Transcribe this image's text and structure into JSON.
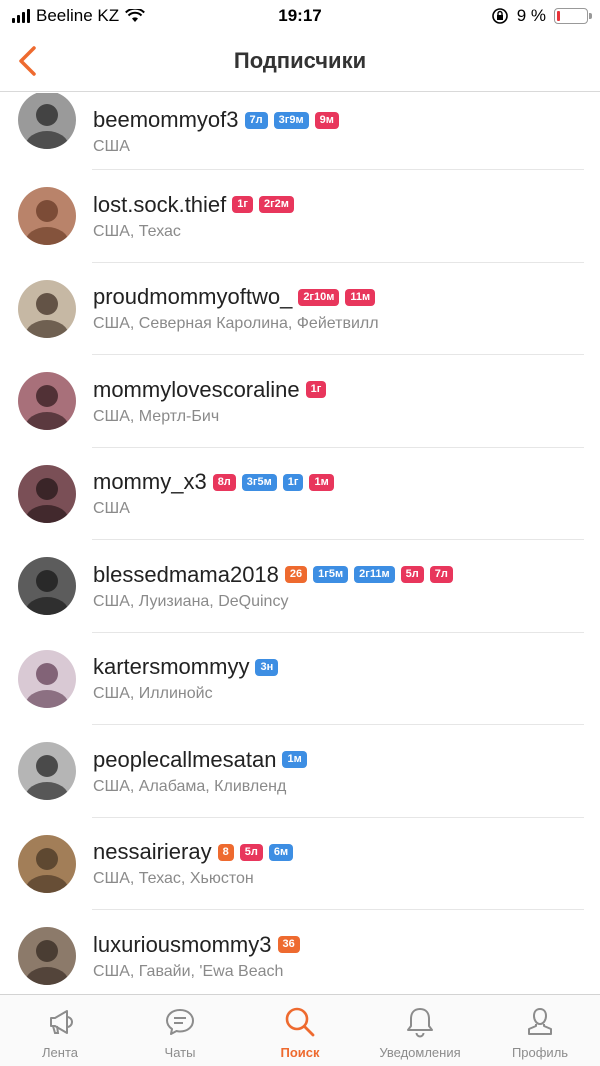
{
  "status_bar": {
    "carrier": "Beeline KZ",
    "time": "19:17",
    "battery_percent": "9 %",
    "battery_level": 0.09,
    "battery_color": "#e8343a"
  },
  "nav": {
    "back_icon": "chevron-left-icon",
    "title": "Подписчики"
  },
  "colors": {
    "accent": "#ee6a2f",
    "badge_blue": "#3d8ee3",
    "badge_pink": "#e8365c",
    "badge_orange": "#ee6a2f"
  },
  "followers": [
    {
      "name": "beemommyof3",
      "location": "США",
      "badges": [
        {
          "text": "7л",
          "color": "#3d8ee3"
        },
        {
          "text": "3г9м",
          "color": "#3d8ee3"
        },
        {
          "text": "9м",
          "color": "#e8365c"
        }
      ],
      "avatar_bg": "#9a9a9a",
      "avatar_fg": "#2d2d2d"
    },
    {
      "name": "lost.sock.thief",
      "location": "США, Техас",
      "badges": [
        {
          "text": "1г",
          "color": "#e8365c"
        },
        {
          "text": "2г2м",
          "color": "#e8365c"
        }
      ],
      "avatar_bg": "#b9836a",
      "avatar_fg": "#6d3f2a"
    },
    {
      "name": "proudmommyoftwo_",
      "location": "США, Северная Каролина, Фейетвилл",
      "badges": [
        {
          "text": "2г10м",
          "color": "#e8365c"
        },
        {
          "text": "11м",
          "color": "#e8365c"
        }
      ],
      "avatar_bg": "#c6b8a4",
      "avatar_fg": "#4a3a2e"
    },
    {
      "name": "mommylovescoraline",
      "location": "США, Мертл-Бич",
      "badges": [
        {
          "text": "1г",
          "color": "#e8365c"
        }
      ],
      "avatar_bg": "#a8707a",
      "avatar_fg": "#3b2226"
    },
    {
      "name": "mommy_x3",
      "location": "США",
      "badges": [
        {
          "text": "8л",
          "color": "#e8365c"
        },
        {
          "text": "3г5м",
          "color": "#3d8ee3"
        },
        {
          "text": "1г",
          "color": "#3d8ee3"
        },
        {
          "text": "1м",
          "color": "#e8365c"
        }
      ],
      "avatar_bg": "#7a4f56",
      "avatar_fg": "#2b1a1d"
    },
    {
      "name": "blessedmama2018",
      "location": "США, Луизиана, DeQuincy",
      "badges": [
        {
          "text": "26",
          "color": "#ee6a2f"
        },
        {
          "text": "1г5м",
          "color": "#3d8ee3"
        },
        {
          "text": "2г11м",
          "color": "#3d8ee3"
        },
        {
          "text": "5л",
          "color": "#e8365c"
        },
        {
          "text": "7л",
          "color": "#e8365c"
        }
      ],
      "avatar_bg": "#5c5c5c",
      "avatar_fg": "#1d1d1d"
    },
    {
      "name": "kartersmommyy",
      "location": "США, Иллинойс",
      "badges": [
        {
          "text": "3н",
          "color": "#3d8ee3"
        }
      ],
      "avatar_bg": "#d9c9d4",
      "avatar_fg": "#6b4a5f"
    },
    {
      "name": "peoplecallmesatan",
      "location": "США, Алабама, Кливленд",
      "badges": [
        {
          "text": "1м",
          "color": "#3d8ee3"
        }
      ],
      "avatar_bg": "#b5b5b5",
      "avatar_fg": "#2f2f2f"
    },
    {
      "name": "nessairieray",
      "location": "США, Техас, Хьюстон",
      "badges": [
        {
          "text": "8",
          "color": "#ee6a2f"
        },
        {
          "text": "5л",
          "color": "#e8365c"
        },
        {
          "text": "6м",
          "color": "#3d8ee3"
        }
      ],
      "avatar_bg": "#a27e58",
      "avatar_fg": "#4e3b28"
    },
    {
      "name": "luxuriousmommy3",
      "location": "США, Гавайи, 'Ewa Beach",
      "badges": [
        {
          "text": "36",
          "color": "#ee6a2f"
        }
      ],
      "avatar_bg": "#8c7a6a",
      "avatar_fg": "#3a2e26"
    }
  ],
  "tabs": [
    {
      "label": "Лента",
      "icon": "megaphone-icon",
      "active": false
    },
    {
      "label": "Чаты",
      "icon": "chat-bubble-icon",
      "active": false
    },
    {
      "label": "Поиск",
      "icon": "search-icon",
      "active": true
    },
    {
      "label": "Уведомления",
      "icon": "bell-icon",
      "active": false
    },
    {
      "label": "Профиль",
      "icon": "user-icon",
      "active": false
    }
  ]
}
